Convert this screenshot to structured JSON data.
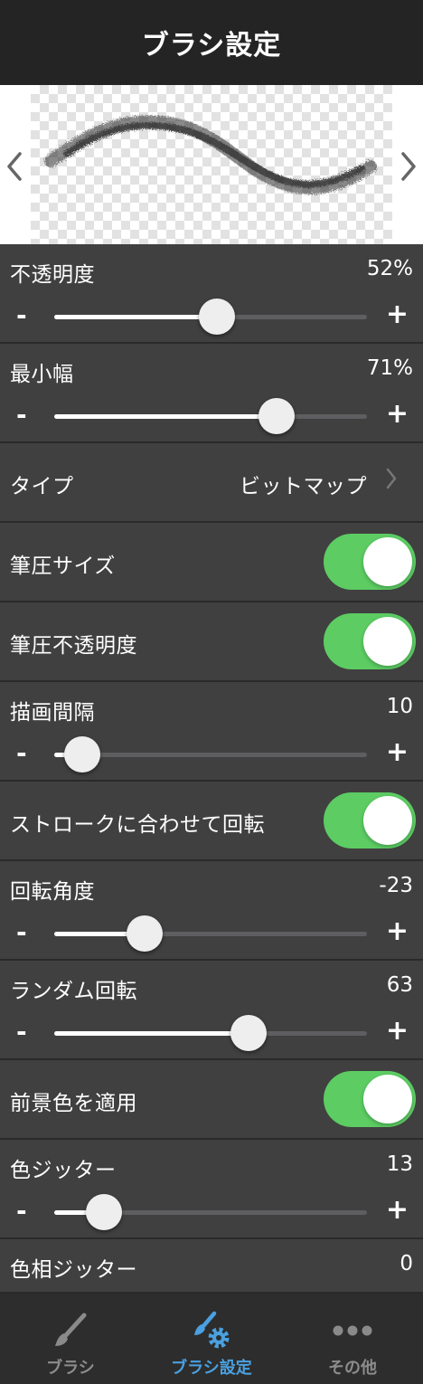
{
  "header": {
    "title": "ブラシ設定"
  },
  "preview": {
    "prev_icon": "chevron-left-icon",
    "next_icon": "chevron-right-icon"
  },
  "settings": {
    "opacity": {
      "label": "不透明度",
      "value": "52%",
      "level": 0.52
    },
    "min_width": {
      "label": "最小幅",
      "value": "71%",
      "level": 0.71
    },
    "type": {
      "label": "タイプ",
      "value": "ビットマップ"
    },
    "pressure_size": {
      "label": "筆圧サイズ",
      "on": true
    },
    "pressure_opacity": {
      "label": "筆圧不透明度",
      "on": true
    },
    "spacing": {
      "label": "描画間隔",
      "value": "10",
      "level": 0.09
    },
    "rotate_stroke": {
      "label": "ストロークに合わせて回転",
      "on": true
    },
    "rotation_angle": {
      "label": "回転角度",
      "value": "-23",
      "level": 0.29
    },
    "random_rotation": {
      "label": "ランダム回転",
      "value": "63",
      "level": 0.62
    },
    "foreground": {
      "label": "前景色を適用",
      "on": true
    },
    "color_jitter": {
      "label": "色ジッター",
      "value": "13",
      "level": 0.16
    },
    "hue_jitter": {
      "label": "色相ジッター",
      "value": "0"
    }
  },
  "slider": {
    "minus": "-",
    "plus": "+"
  },
  "colors": {
    "toggle_on": "#5ccc63",
    "active_tab": "#4aa0e0"
  },
  "tabs": [
    {
      "label": "ブラシ",
      "icon": "brush-icon",
      "active": false
    },
    {
      "label": "ブラシ設定",
      "icon": "brush-settings-icon",
      "active": true
    },
    {
      "label": "その他",
      "icon": "more-icon",
      "active": false
    }
  ]
}
